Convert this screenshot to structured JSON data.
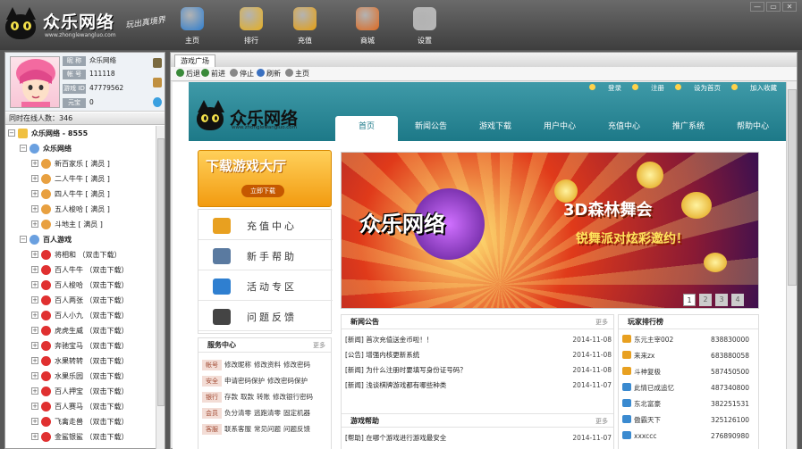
{
  "app": {
    "logo_text": "众乐网络",
    "logo_url": "www.zhonglewangluo.com",
    "slogan": "玩出真境界"
  },
  "nav": [
    {
      "label": "主页",
      "icon": "ie-icon",
      "color": "#2f7fd0"
    },
    {
      "label": "排行",
      "icon": "rank-icon",
      "color": "#e8b020"
    },
    {
      "label": "充值",
      "icon": "coins-icon",
      "color": "#e8a010"
    },
    {
      "label": "商城",
      "icon": "shop-icon",
      "color": "#e06a20"
    },
    {
      "label": "设置",
      "icon": "gear-icon",
      "color": "#b8b8b8"
    }
  ],
  "window_controls": [
    "—",
    "▭",
    "✕"
  ],
  "profile": {
    "rows": [
      {
        "key": "昵 称",
        "value": "众乐网络"
      },
      {
        "key": "帐 号",
        "value": "111118"
      },
      {
        "key": "游戏 ID",
        "value": "47779562"
      },
      {
        "key": "元宝",
        "value": "0"
      }
    ]
  },
  "online_count": "同时在线人数：346",
  "tree": [
    {
      "level": 0,
      "expand": "−",
      "icon": "folder-icon",
      "color": "#f0c040",
      "text": "众乐网络 - 8555",
      "bold": true
    },
    {
      "level": 1,
      "expand": "−",
      "icon": "group-icon",
      "color": "#6aa0e0",
      "text": "众乐网络",
      "bold": true
    },
    {
      "level": 2,
      "expand": "+",
      "icon": "game-icon",
      "color": "#e8a040",
      "text": "新百家乐 [ 满员 ]"
    },
    {
      "level": 2,
      "expand": "+",
      "icon": "game-icon",
      "color": "#e8a040",
      "text": "二人牛牛 [ 满员 ]"
    },
    {
      "level": 2,
      "expand": "+",
      "icon": "game-icon",
      "color": "#e8a040",
      "text": "四人牛牛 [ 满员 ]"
    },
    {
      "level": 2,
      "expand": "+",
      "icon": "game-icon",
      "color": "#e8a040",
      "text": "五人梭哈 [ 满员 ]"
    },
    {
      "level": 2,
      "expand": "+",
      "icon": "game-icon",
      "color": "#e8a040",
      "text": "斗地主 [ 满员 ]"
    },
    {
      "level": 1,
      "expand": "−",
      "icon": "group-icon",
      "color": "#6aa0e0",
      "text": "百人游戏",
      "bold": true
    },
    {
      "level": 2,
      "expand": "+",
      "icon": "blocked-icon",
      "color": "#e03030",
      "text": "将相和 （双击下载）"
    },
    {
      "level": 2,
      "expand": "+",
      "icon": "blocked-icon",
      "color": "#e03030",
      "text": "百人牛牛 （双击下载）"
    },
    {
      "level": 2,
      "expand": "+",
      "icon": "blocked-icon",
      "color": "#e03030",
      "text": "百人梭哈 （双击下载）"
    },
    {
      "level": 2,
      "expand": "+",
      "icon": "blocked-icon",
      "color": "#e03030",
      "text": "百人两张 （双击下载）"
    },
    {
      "level": 2,
      "expand": "+",
      "icon": "blocked-icon",
      "color": "#e03030",
      "text": "百人小九 （双击下载）"
    },
    {
      "level": 2,
      "expand": "+",
      "icon": "blocked-icon",
      "color": "#e03030",
      "text": "虎虎生威 （双击下载）"
    },
    {
      "level": 2,
      "expand": "+",
      "icon": "blocked-icon",
      "color": "#e03030",
      "text": "奔驰宝马 （双击下载）"
    },
    {
      "level": 2,
      "expand": "+",
      "icon": "blocked-icon",
      "color": "#e03030",
      "text": "水果转转 （双击下载）"
    },
    {
      "level": 2,
      "expand": "+",
      "icon": "blocked-icon",
      "color": "#e03030",
      "text": "水果乐园 （双击下载）"
    },
    {
      "level": 2,
      "expand": "+",
      "icon": "blocked-icon",
      "color": "#e03030",
      "text": "百人押宝 （双击下载）"
    },
    {
      "level": 2,
      "expand": "+",
      "icon": "blocked-icon",
      "color": "#e03030",
      "text": "百人赛马 （双击下载）"
    },
    {
      "level": 2,
      "expand": "+",
      "icon": "blocked-icon",
      "color": "#e03030",
      "text": "飞禽走兽 （双击下载）"
    },
    {
      "level": 2,
      "expand": "+",
      "icon": "blocked-icon",
      "color": "#e03030",
      "text": "金鲨银鲨 （双击下载）"
    }
  ],
  "browser": {
    "tab": "游戏广场",
    "toolbar": [
      {
        "label": "后退",
        "icon": "back-icon",
        "color": "#3a8a3a"
      },
      {
        "label": "前进",
        "icon": "forward-icon",
        "color": "#3a8a3a"
      },
      {
        "label": "停止",
        "icon": "stop-icon",
        "color": "#888888"
      },
      {
        "label": "刷新",
        "icon": "refresh-icon",
        "color": "#3a70c0"
      },
      {
        "label": "主页",
        "icon": "home-icon",
        "color": "#888888"
      }
    ]
  },
  "site": {
    "logo_text": "众乐网络",
    "logo_url": "www.zhonglewangluo.com",
    "top_links": [
      "登录",
      "注册",
      "设为首页",
      "加入收藏"
    ],
    "menu": [
      "首页",
      "新闻公告",
      "游戏下载",
      "用户中心",
      "充值中心",
      "推广系统",
      "帮助中心"
    ],
    "download": {
      "title": "下载游戏大厅",
      "button": "立即下载"
    },
    "side_menu": [
      {
        "label": "充值中心",
        "icon": "recharge-icon",
        "color": "#e8a020"
      },
      {
        "label": "新手帮助",
        "icon": "book-icon",
        "color": "#5a7aa0"
      },
      {
        "label": "活动专区",
        "icon": "event-icon",
        "color": "#2f7fd0"
      },
      {
        "label": "问题反馈",
        "icon": "feedback-icon",
        "color": "#444444"
      }
    ],
    "service": {
      "title": "服务中心",
      "more": "更多",
      "rows": [
        {
          "tag": "帐号",
          "links": [
            "修改昵称",
            "修改资料",
            "修改密码"
          ]
        },
        {
          "tag": "安全",
          "links": [
            "申请密码保护",
            "修改密码保护"
          ]
        },
        {
          "tag": "银行",
          "links": [
            "存款",
            "取款",
            "转账",
            "修改银行密码"
          ]
        },
        {
          "tag": "会员",
          "links": [
            "负分清零",
            "逃跑清零",
            "固定机器"
          ]
        },
        {
          "tag": "客服",
          "links": [
            "联系客服",
            "常见问题",
            "问题反馈"
          ]
        }
      ]
    },
    "promo": {
      "title": "3D森林舞会",
      "subtitle": "锐舞派对炫彩邀约！",
      "watermark": "众乐网络",
      "pages": [
        "1",
        "2",
        "3",
        "4"
      ]
    },
    "news": {
      "title": "新闻公告",
      "more": "更多",
      "items": [
        {
          "text": "[新闻] 首次充值送金币啦！！",
          "date": "2014-11-08"
        },
        {
          "text": "[公告] 增强内核更新系统",
          "date": "2014-11-08"
        },
        {
          "text": "[新闻] 为什么注册时要填写身份证号码？",
          "date": "2014-11-08"
        },
        {
          "text": "[新闻] 浅谈棋牌游戏都有哪些种类",
          "date": "2014-11-07"
        }
      ]
    },
    "help": {
      "title": "游戏帮助",
      "more": "更多",
      "items": [
        {
          "text": "[帮助] 在哪个游戏进行游戏最安全",
          "date": "2014-11-07"
        }
      ]
    },
    "rank": {
      "title": "玩家排行榜",
      "items": [
        {
          "name": "东元主宰002",
          "value": "838830000",
          "color": "#e8a020"
        },
        {
          "name": "来来zx",
          "value": "683880058",
          "color": "#e8a020"
        },
        {
          "name": "斗神复极",
          "value": "587450500",
          "color": "#e8a020"
        },
        {
          "name": "此情已成追忆",
          "value": "487340800",
          "color": "#3a8ad0"
        },
        {
          "name": "东北富豪",
          "value": "382251531",
          "color": "#3a8ad0"
        },
        {
          "name": "傲霸天下",
          "value": "325126100",
          "color": "#3a8ad0"
        },
        {
          "name": "xxxccc",
          "value": "276890980",
          "color": "#3a8ad0"
        }
      ]
    }
  }
}
